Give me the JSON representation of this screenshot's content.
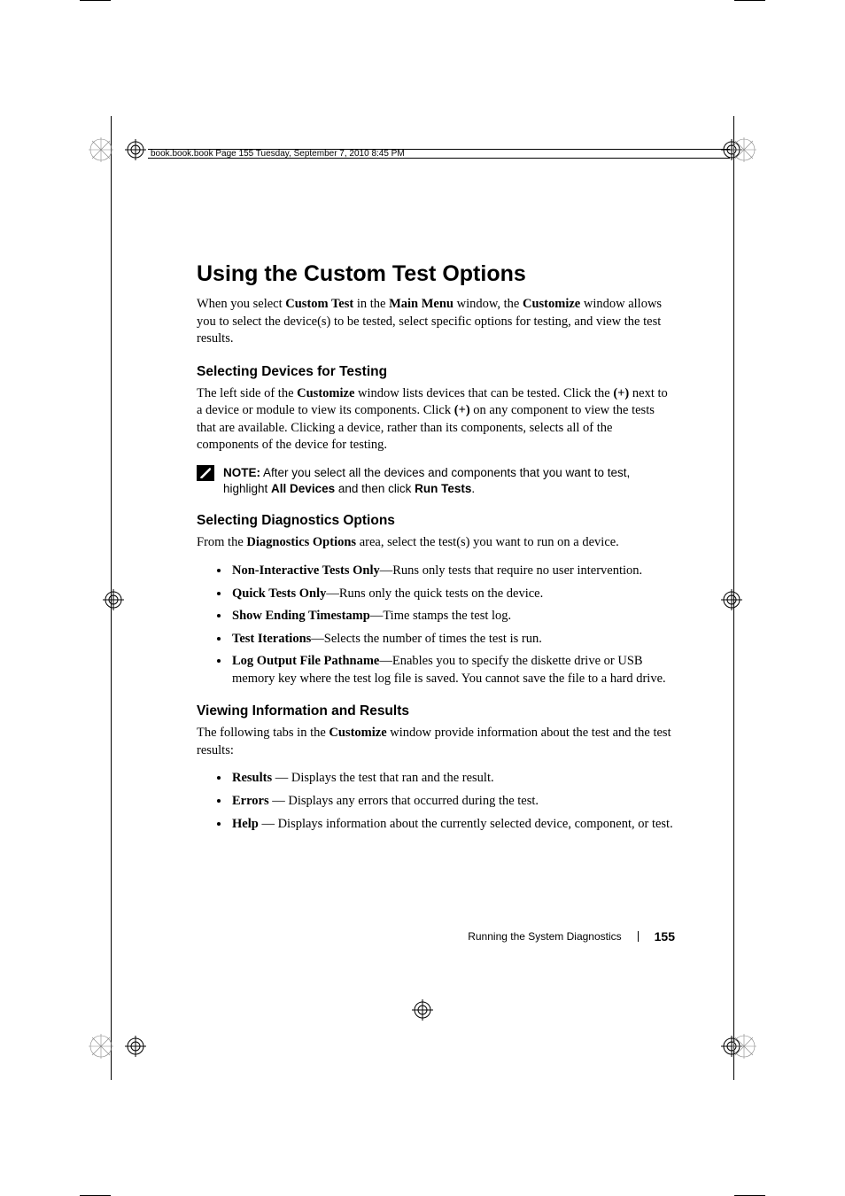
{
  "header_line": "book.book.book  Page 155  Tuesday, September 7, 2010  8:45 PM",
  "heading": "Using the Custom Test Options",
  "intro": {
    "pre": "When you select ",
    "b1": "Custom Test",
    "mid1": " in the ",
    "b2": "Main Menu",
    "mid2": " window, the ",
    "b3": "Customize",
    "post": " window allows you to select the device(s) to be tested, select specific options for testing, and view the test results."
  },
  "selecting_devices": {
    "h": "Selecting Devices for Testing",
    "p_pre": "The left side of the ",
    "p_b1": "Customize",
    "p_mid1": " window lists devices that can be tested. Click the ",
    "p_b2": "(+)",
    "p_mid2": " next to a device or module to view its components. Click ",
    "p_b3": "(+)",
    "p_post": " on any component to view the tests that are available. Clicking a device, rather than its components, selects all of the components of the device for testing."
  },
  "note": {
    "label": "NOTE:",
    "pre": " After you select all the devices and components that you want to test, highlight ",
    "b1": "All Devices",
    "mid": " and then click ",
    "b2": "Run Tests",
    "post": "."
  },
  "diag": {
    "h": "Selecting Diagnostics Options",
    "p_pre": "From the ",
    "p_b": "Diagnostics Options",
    "p_post": " area, select the test(s) you want to run on a device.",
    "items": [
      {
        "b": "Non-Interactive Tests Only",
        "t": "—Runs only tests that require no user intervention."
      },
      {
        "b": "Quick Tests Only",
        "t": "—Runs only the quick tests on the device."
      },
      {
        "b": "Show Ending Timestamp",
        "t": "—Time stamps the test log."
      },
      {
        "b": "Test Iterations",
        "t": "—Selects the number of times the test is run."
      },
      {
        "b": "Log Output File Pathname",
        "t": "—Enables you to specify the diskette drive or USB memory key where the test log file is saved. You cannot save the file to a hard drive."
      }
    ]
  },
  "results": {
    "h": "Viewing Information and Results",
    "p_pre": "The following tabs in the ",
    "p_b": "Customize",
    "p_post": " window provide information about the test and the test results:",
    "items": [
      {
        "b": "Results",
        "t": " — Displays the test that ran and the result."
      },
      {
        "b": "Errors",
        "t": " — Displays any errors that occurred during the test."
      },
      {
        "b": "Help",
        "t": " — Displays information about the currently selected device, component, or test."
      }
    ]
  },
  "footer": {
    "section": "Running the System Diagnostics",
    "page": "155"
  }
}
